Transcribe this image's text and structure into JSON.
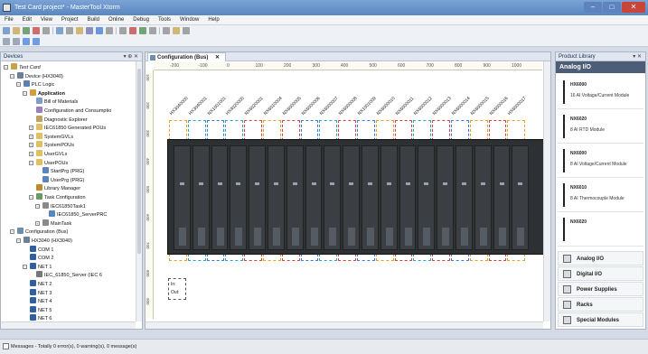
{
  "window": {
    "title": "Test Card project* - MasterTool Xtorm",
    "minimize": "–",
    "maximize": "□",
    "close": "✕"
  },
  "menu": [
    "File",
    "Edit",
    "View",
    "Project",
    "Build",
    "Online",
    "Debug",
    "Tools",
    "Window",
    "Help"
  ],
  "devices_panel": {
    "title": "Devices",
    "controls": "▾ ⊕ ✕",
    "tree": [
      {
        "label": "Test Card",
        "indent": 0,
        "exp": "⊟",
        "icon": "#c8a24a",
        "italic": true
      },
      {
        "label": "Device (HX3040)",
        "indent": 1,
        "exp": "⊟",
        "icon": "#6b7f9a"
      },
      {
        "label": "PLC Logic",
        "indent": 2,
        "exp": "⊟",
        "icon": "#5a7fb0"
      },
      {
        "label": "Application",
        "indent": 3,
        "exp": "⊟",
        "icon": "#d0a040",
        "bold": true
      },
      {
        "label": "Bill of Materials",
        "indent": 4,
        "icon": "#7f9fc9"
      },
      {
        "label": "Configuration and Consumptio",
        "indent": 4,
        "icon": "#9a7fc0"
      },
      {
        "label": "Diagnostic Explorer",
        "indent": 4,
        "icon": "#c0a060"
      },
      {
        "label": "IEC61850 Generated POUs",
        "indent": 4,
        "exp": "⊞",
        "icon": "#e0c060"
      },
      {
        "label": "SystemGVLs",
        "indent": 4,
        "exp": "⊞",
        "icon": "#e0c060"
      },
      {
        "label": "SystemPOUs",
        "indent": 4,
        "exp": "⊞",
        "icon": "#e0c060"
      },
      {
        "label": "UserGVLs",
        "indent": 4,
        "exp": "⊞",
        "icon": "#e0c060"
      },
      {
        "label": "UserPOUs",
        "indent": 4,
        "exp": "⊟",
        "icon": "#e0c060"
      },
      {
        "label": "StartPrg (PRG)",
        "indent": 5,
        "icon": "#5a86c0"
      },
      {
        "label": "UserPrg (PRG)",
        "indent": 5,
        "icon": "#5a86c0"
      },
      {
        "label": "Library Manager",
        "indent": 4,
        "icon": "#c08a30"
      },
      {
        "label": "Task Configuration",
        "indent": 4,
        "exp": "⊟",
        "icon": "#6a9a6a"
      },
      {
        "label": "IEC61850Task1",
        "indent": 5,
        "exp": "⊟",
        "icon": "#8a8a8a"
      },
      {
        "label": "IEC61850_ServerPRC",
        "indent": 6,
        "icon": "#5a86c0"
      },
      {
        "label": "MainTask",
        "indent": 5,
        "exp": "⊞",
        "icon": "#8a8a8a"
      },
      {
        "label": "Configuration (Bus)",
        "indent": 1,
        "exp": "⊟",
        "icon": "#6b8fb0"
      },
      {
        "label": "HX3040 (HX3040)",
        "indent": 2,
        "exp": "⊟",
        "icon": "#6b7f9a"
      },
      {
        "label": "COM 1",
        "indent": 3,
        "icon": "#3060a0"
      },
      {
        "label": "COM 2",
        "indent": 3,
        "icon": "#3060a0"
      },
      {
        "label": "NET 1",
        "indent": 3,
        "exp": "⊟",
        "icon": "#3060a0"
      },
      {
        "label": "IEC_61850_Server (IEC 6",
        "indent": 4,
        "icon": "#777"
      },
      {
        "label": "NET 2",
        "indent": 3,
        "icon": "#3060a0"
      },
      {
        "label": "NET 3",
        "indent": 3,
        "icon": "#3060a0"
      },
      {
        "label": "NET 4",
        "indent": 3,
        "icon": "#3060a0"
      },
      {
        "label": "NET 5",
        "indent": 3,
        "icon": "#3060a0"
      },
      {
        "label": "NET 6",
        "indent": 3,
        "icon": "#3060a0"
      }
    ]
  },
  "editor": {
    "tab_label": "Configuration (Bus)",
    "tab_close": "✕",
    "ruler_h": [
      "-200",
      "-100",
      "0",
      "100",
      "200",
      "300",
      "400",
      "500",
      "600",
      "700",
      "800",
      "900",
      "1000"
    ],
    "ruler_v": [
      "100",
      "200",
      "300",
      "400",
      "500",
      "600",
      "700",
      "800",
      "900"
    ],
    "modules": [
      "HX3040000",
      "HX3040001",
      "NX1001001",
      "HX4020000",
      "NX6020001",
      "NX6010004",
      "NX6000005",
      "NX6000006",
      "NX6000007",
      "NX6000008",
      "NX1001009",
      "NX6000010",
      "NX6000011",
      "NX6000012",
      "NX6000013",
      "NX6000014",
      "NX6000015",
      "NX6000016",
      "HX6000017"
    ],
    "io_in": "In:",
    "io_out": "Out:"
  },
  "library": {
    "title": "Product Library",
    "controls": "▾ ✕",
    "header": "Analog I/O",
    "items": [
      {
        "name": "HX6000",
        "desc": "16 AI Voltage/Current Module"
      },
      {
        "name": "NX6020",
        "desc": "8 AI RTD Module"
      },
      {
        "name": "NX6000",
        "desc": "8 AI Voltage/Current Module"
      },
      {
        "name": "NX6010",
        "desc": "8 AI Thermocouple Module"
      },
      {
        "name": "NX6020",
        "desc": ""
      }
    ],
    "categories": [
      "Analog I/O",
      "Digital I/O",
      "Power Supplies",
      "Racks",
      "Special Modules"
    ]
  },
  "status": {
    "text": "Messages - Totally 0 error(s), 0 warning(s), 0 message(s)"
  },
  "colors": {
    "accent": "#5a86c0",
    "dash": [
      "#3a78d8",
      "#2aa0c8",
      "#d84040",
      "#e0a020"
    ]
  }
}
